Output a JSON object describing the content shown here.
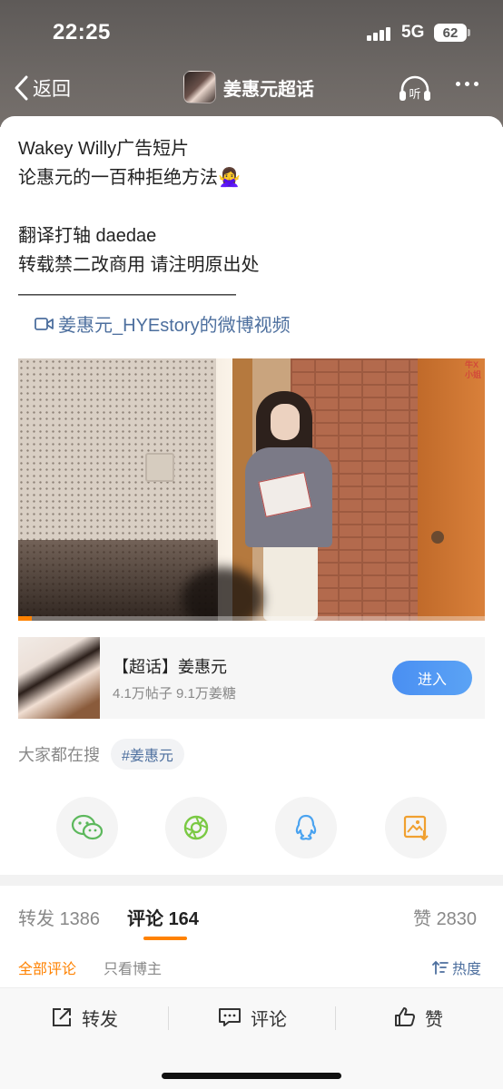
{
  "status_bar": {
    "time": "22:25",
    "network": "5G",
    "battery": "62"
  },
  "nav": {
    "back_label": "返回",
    "title": "姜惠元超话",
    "listen_label": "听"
  },
  "post": {
    "lines": [
      "Wakey Willy广告短片",
      "论惠元的一百种拒绝方法🙅‍♀️",
      "",
      "翻译打轴 daedae",
      "转载禁二改商用 请注明原出处",
      "————————————"
    ],
    "video_link": "姜惠元_HYEstory的微博视频",
    "video_watermark": "牛X\n小姐"
  },
  "video": {
    "progress": 0.03
  },
  "chaohua": {
    "name": "【超话】姜惠元",
    "stats": "4.1万帖子 9.1万姜糖",
    "enter_label": "进入"
  },
  "search": {
    "label": "大家都在搜",
    "tag": "#姜惠元"
  },
  "share_icons": [
    "wechat-icon",
    "moments-icon",
    "qq-icon",
    "save-image-icon"
  ],
  "tabs": {
    "repost": {
      "label": "转发",
      "count": "1386"
    },
    "comment": {
      "label": "评论",
      "count": "164"
    },
    "like": {
      "label": "赞",
      "count": "2830"
    }
  },
  "subtabs": {
    "all": "全部评论",
    "author": "只看博主",
    "sort": "热度"
  },
  "bottom_bar": {
    "repost": "转发",
    "comment": "评论",
    "like": "赞"
  },
  "colors": {
    "accent": "#ff8200",
    "link": "#4d6f9e",
    "enter_button": "#4a8ff2"
  }
}
